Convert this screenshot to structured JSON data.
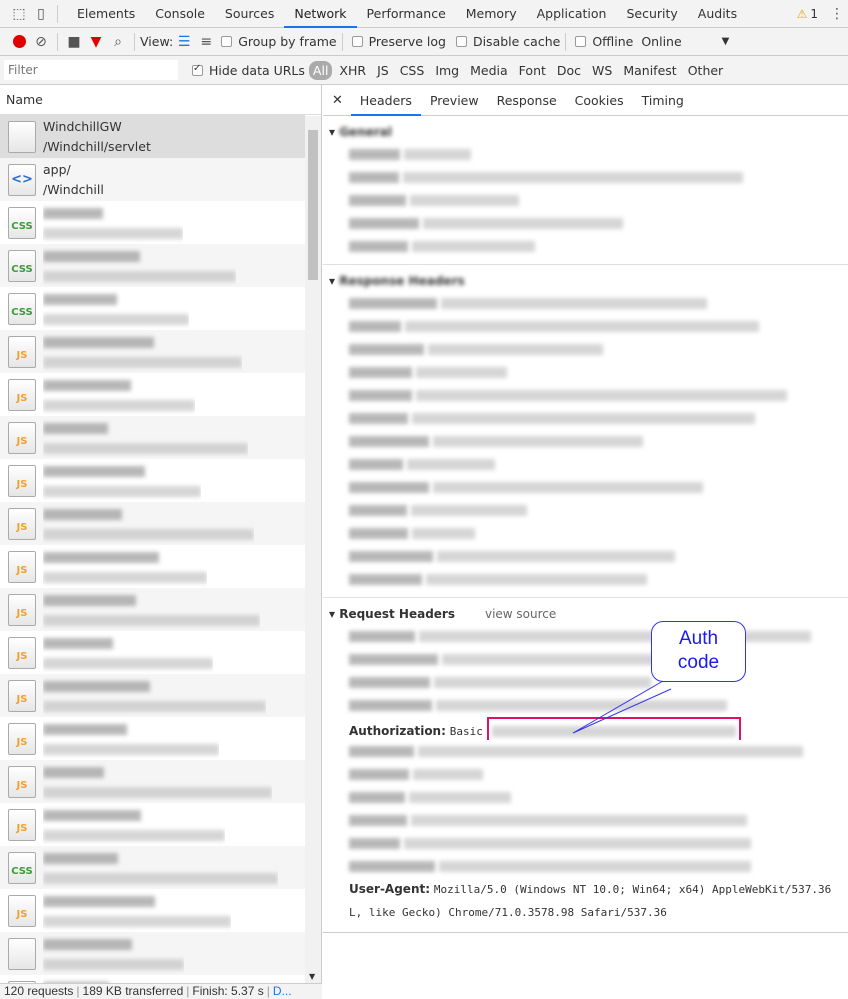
{
  "tabs": [
    "Elements",
    "Console",
    "Sources",
    "Network",
    "Performance",
    "Memory",
    "Application",
    "Security",
    "Audits"
  ],
  "active_tab": "Network",
  "warning_count": "1",
  "toolbar": {
    "view_label": "View:",
    "group_by_frame": "Group by frame",
    "preserve_log": "Preserve log",
    "disable_cache": "Disable cache",
    "offline": "Offline",
    "throttle": "Online"
  },
  "filter": {
    "placeholder": "Filter",
    "hide_data_urls": "Hide data URLs",
    "types": [
      "All",
      "XHR",
      "JS",
      "CSS",
      "Img",
      "Media",
      "Font",
      "Doc",
      "WS",
      "Manifest",
      "Other"
    ]
  },
  "requests": {
    "header": "Name",
    "items": [
      {
        "name": "WindchillGW",
        "path": "/Windchill/servlet",
        "type": "blank"
      },
      {
        "name": "app/",
        "path": "/Windchill",
        "type": "html"
      }
    ],
    "blurred_types": [
      "css",
      "css",
      "css",
      "js",
      "js",
      "js",
      "js",
      "js",
      "js",
      "js",
      "js",
      "js",
      "js",
      "js",
      "js",
      "css",
      "js",
      "blank",
      "js"
    ]
  },
  "status": {
    "requests": "120 requests",
    "transferred": "189 KB transferred",
    "finish": "Finish: 5.37 s",
    "more": "D..."
  },
  "details": {
    "tabs": [
      "Headers",
      "Preview",
      "Response",
      "Cookies",
      "Timing"
    ],
    "active": "Headers",
    "general": "General",
    "response_headers": "Response Headers",
    "request_headers": "Request Headers",
    "view_source": "view source",
    "auth_key": "Authorization:",
    "auth_value": "Basic",
    "ua_key": "User-Agent:",
    "ua_value": "Mozilla/5.0 (Windows NT 10.0; Win64; x64) AppleWebKit/537.36",
    "ua_cont": "L, like Gecko) Chrome/71.0.3578.98 Safari/537.36"
  },
  "callout": {
    "line1": "Auth",
    "line2": "code"
  }
}
